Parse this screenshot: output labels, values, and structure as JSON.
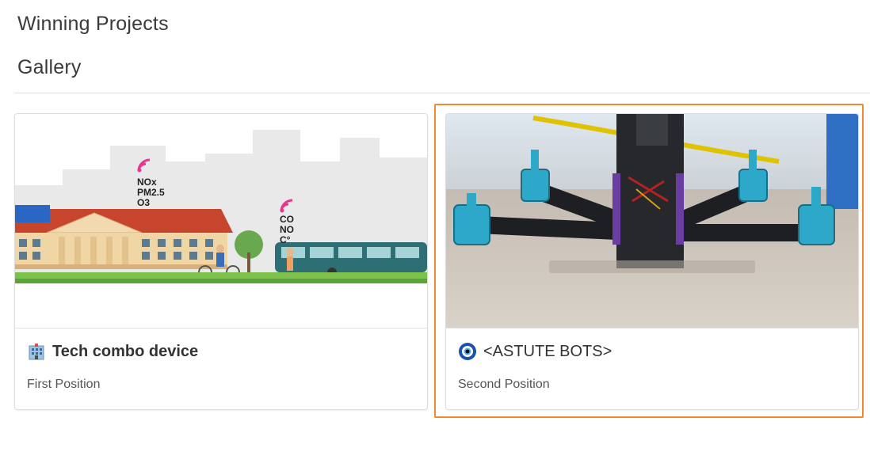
{
  "section": {
    "title": "Winning Projects",
    "subtitle": "Gallery"
  },
  "cards": [
    {
      "title": "Tech combo device",
      "position": "First Position",
      "icon": "office-building-icon",
      "image": "city-air-quality-illustration",
      "image_labels": {
        "group1": [
          "NOx",
          "PM2.5",
          "O3"
        ],
        "group2": [
          "CO",
          "NO",
          "C°"
        ]
      }
    },
    {
      "title": "<ASTUTE BOTS>",
      "position": "Second Position",
      "icon": "nazar-eye-icon",
      "image": "quadcopter-drone-photo",
      "selected": true
    }
  ],
  "colors": {
    "selection_outline": "#f0892f",
    "divider": "#dedede"
  }
}
